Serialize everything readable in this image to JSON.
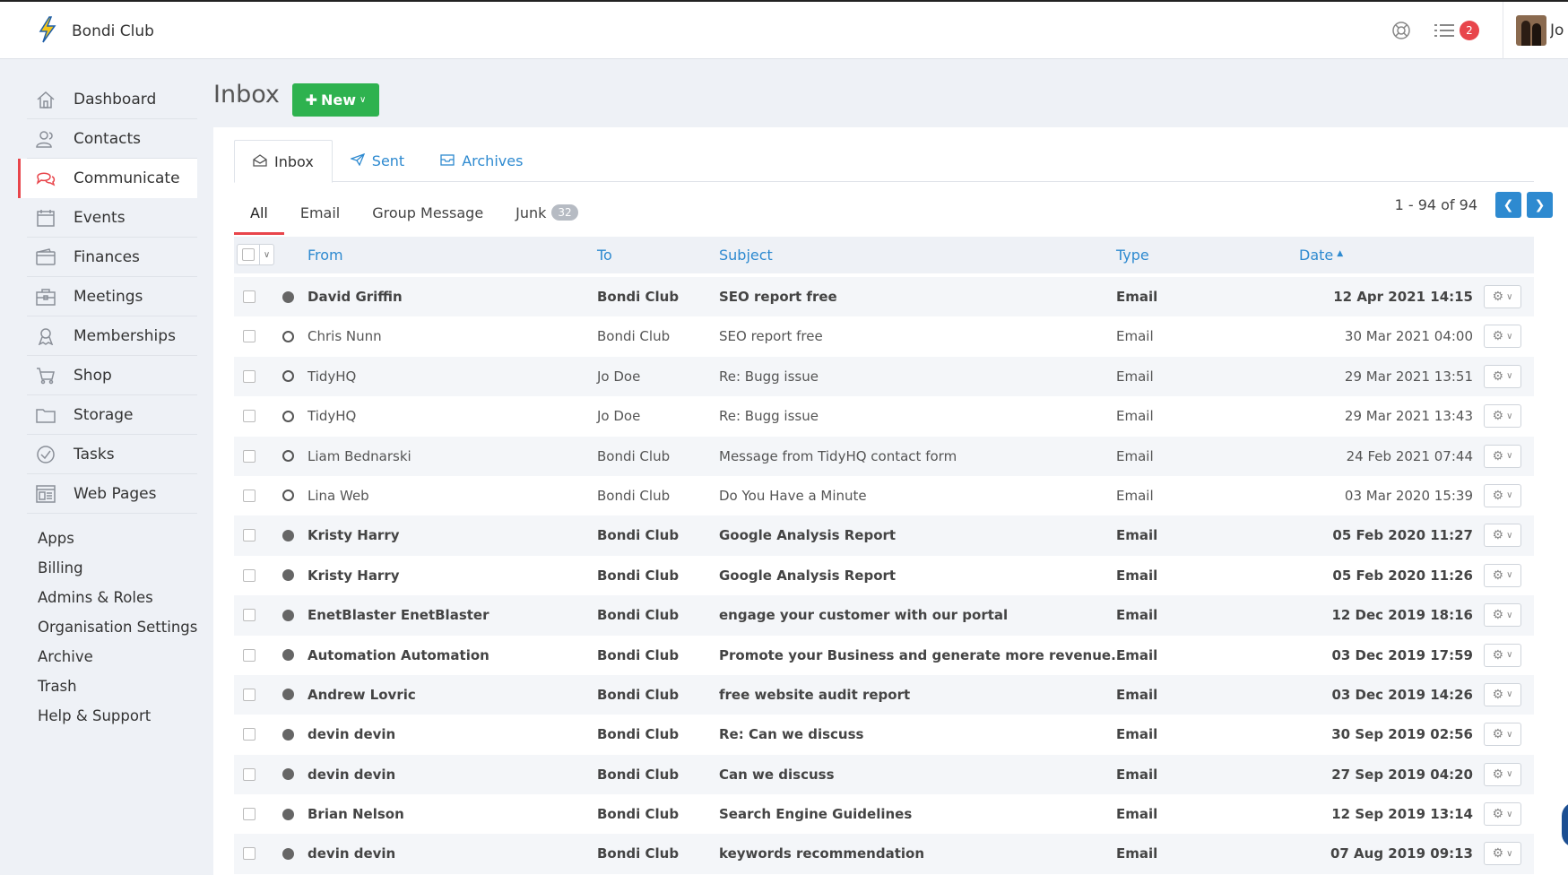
{
  "header": {
    "brand_name": "Bondi Club",
    "notifications_count": "2",
    "user_name": "Jo"
  },
  "sidebar": {
    "items": [
      {
        "label": "Dashboard",
        "icon": "home-icon"
      },
      {
        "label": "Contacts",
        "icon": "contacts-icon"
      },
      {
        "label": "Communicate",
        "icon": "chat-icon"
      },
      {
        "label": "Events",
        "icon": "calendar-icon"
      },
      {
        "label": "Finances",
        "icon": "wallet-icon"
      },
      {
        "label": "Meetings",
        "icon": "briefcase-icon"
      },
      {
        "label": "Memberships",
        "icon": "membership-icon"
      },
      {
        "label": "Shop",
        "icon": "cart-icon"
      },
      {
        "label": "Storage",
        "icon": "folder-icon"
      },
      {
        "label": "Tasks",
        "icon": "check-circle-icon"
      },
      {
        "label": "Web Pages",
        "icon": "webpage-icon"
      }
    ],
    "active": "Communicate",
    "links": [
      "Apps",
      "Billing",
      "Admins & Roles",
      "Organisation Settings",
      "Archive",
      "Trash",
      "Help & Support"
    ]
  },
  "page": {
    "title": "Inbox",
    "new_button": "New"
  },
  "tabs": [
    "Inbox",
    "Sent",
    "Archives"
  ],
  "filters": {
    "all": "All",
    "email": "Email",
    "group": "Group Message",
    "junk": "Junk",
    "junk_count": "32"
  },
  "pager": {
    "text": "1 - 94 of 94"
  },
  "table": {
    "headers": {
      "from": "From",
      "to": "To",
      "subject": "Subject",
      "type": "Type",
      "date": "Date"
    },
    "rows": [
      {
        "from": "David Griffin",
        "to": "Bondi Club",
        "subject": "SEO report free",
        "type": "Email",
        "date": "12 Apr 2021 14:15",
        "unread": true
      },
      {
        "from": "Chris Nunn",
        "to": "Bondi Club",
        "subject": "SEO report free",
        "type": "Email",
        "date": "30 Mar 2021 04:00",
        "unread": false
      },
      {
        "from": "TidyHQ",
        "to": "Jo Doe",
        "subject": "Re: Bugg issue",
        "type": "Email",
        "date": "29 Mar 2021 13:51",
        "unread": false
      },
      {
        "from": "TidyHQ",
        "to": "Jo Doe",
        "subject": "Re: Bugg issue",
        "type": "Email",
        "date": "29 Mar 2021 13:43",
        "unread": false
      },
      {
        "from": "Liam Bednarski",
        "to": "Bondi Club",
        "subject": "Message from TidyHQ contact form",
        "type": "Email",
        "date": "24 Feb 2021 07:44",
        "unread": false
      },
      {
        "from": "Lina Web",
        "to": "Bondi Club",
        "subject": "Do You Have a Minute",
        "type": "Email",
        "date": "03 Mar 2020 15:39",
        "unread": false
      },
      {
        "from": "Kristy Harry",
        "to": "Bondi Club",
        "subject": "Google Analysis Report",
        "type": "Email",
        "date": "05 Feb 2020 11:27",
        "unread": true
      },
      {
        "from": "Kristy Harry",
        "to": "Bondi Club",
        "subject": "Google Analysis Report",
        "type": "Email",
        "date": "05 Feb 2020 11:26",
        "unread": true
      },
      {
        "from": "EnetBlaster EnetBlaster",
        "to": "Bondi Club",
        "subject": "engage your customer with our portal",
        "type": "Email",
        "date": "12 Dec 2019 18:16",
        "unread": true
      },
      {
        "from": "Automation Automation",
        "to": "Bondi Club",
        "subject": "Promote your Business and generate more revenue...",
        "type": "Email",
        "date": "03 Dec 2019 17:59",
        "unread": true
      },
      {
        "from": "Andrew Lovric",
        "to": "Bondi Club",
        "subject": "free website audit report",
        "type": "Email",
        "date": "03 Dec 2019 14:26",
        "unread": true
      },
      {
        "from": "devin devin",
        "to": "Bondi Club",
        "subject": "Re: Can we discuss",
        "type": "Email",
        "date": "30 Sep 2019 02:56",
        "unread": true
      },
      {
        "from": "devin devin",
        "to": "Bondi Club",
        "subject": "Can we discuss",
        "type": "Email",
        "date": "27 Sep 2019 04:20",
        "unread": true
      },
      {
        "from": "Brian Nelson",
        "to": "Bondi Club",
        "subject": "Search Engine Guidelines",
        "type": "Email",
        "date": "12 Sep 2019 13:14",
        "unread": true
      },
      {
        "from": "devin devin",
        "to": "Bondi Club",
        "subject": "keywords recommendation",
        "type": "Email",
        "date": "07 Aug 2019 09:13",
        "unread": true
      }
    ]
  },
  "colors": {
    "accent": "#2e8ad0",
    "active_red": "#e8454b",
    "new_button": "#2eb24f"
  }
}
